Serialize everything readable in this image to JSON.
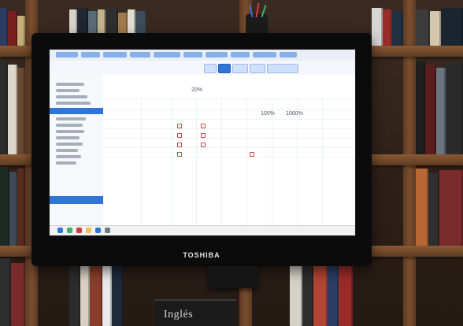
{
  "monitor": {
    "brand": "TOSHIBA"
  },
  "screen": {
    "visible_numbers": [
      "20%",
      "100%",
      "1000%"
    ]
  },
  "foreground": {
    "book_title": "Inglés"
  },
  "colors": {
    "wood": "#7b4f2f",
    "screen_background": "#fbfbfd",
    "accent_blue": "#2f76d6",
    "mark_red": "#d24b4b"
  },
  "icons": {
    "monitor": "display-icon",
    "screen": "spreadsheet-icon"
  }
}
